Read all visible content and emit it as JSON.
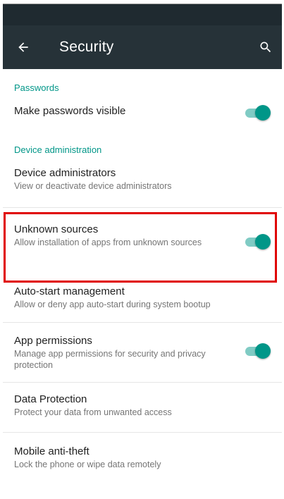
{
  "app_bar": {
    "title": "Security",
    "back_icon": "arrow-back-icon",
    "search_icon": "search-icon",
    "background": "#263238"
  },
  "sections": {
    "passwords": {
      "header": "Passwords",
      "make_passwords_visible": {
        "title": "Make passwords visible",
        "enabled": true
      }
    },
    "device_administration": {
      "header": "Device administration",
      "device_administrators": {
        "title": "Device administrators",
        "subtitle": "View or deactivate device administrators"
      },
      "unknown_sources": {
        "title": "Unknown sources",
        "subtitle": "Allow installation of apps from unknown sources",
        "enabled": true
      },
      "auto_start": {
        "title": "Auto-start management",
        "subtitle": "Allow or deny app auto-start during system bootup"
      },
      "app_permissions": {
        "title": "App permissions",
        "subtitle": "Manage app permissions for security and privacy protection",
        "enabled": true
      },
      "data_protection": {
        "title": "Data Protection",
        "subtitle": "Protect your data from unwanted access"
      },
      "mobile_anti_theft": {
        "title": "Mobile anti-theft",
        "subtitle": "Lock the phone or wipe data remotely"
      }
    }
  },
  "colors": {
    "accent": "#009688",
    "accent_light": "#80cbc4",
    "highlight": "#e00000"
  }
}
